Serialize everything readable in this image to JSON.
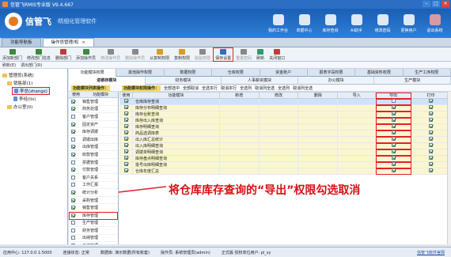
{
  "window": {
    "title": "信管飞RMIS专业版 V9.4.667"
  },
  "header": {
    "brand": "信管飞",
    "slogan": "·精细化管理软件",
    "nav": [
      {
        "label": "我的工作台",
        "icon": "desk-icon"
      },
      {
        "label": "单据中心",
        "icon": "document-icon"
      },
      {
        "label": "库存查询",
        "icon": "warehouse-icon"
      },
      {
        "label": "AI助手",
        "icon": "ai-icon"
      },
      {
        "label": "修改密码",
        "icon": "key-icon"
      },
      {
        "label": "更换用户",
        "icon": "user-switch-icon"
      },
      {
        "label": "退出系统",
        "icon": "power-icon"
      }
    ]
  },
  "doc_tabs": [
    {
      "label": "功能导航板",
      "active": false
    },
    {
      "label": "操作员管理/权",
      "active": true
    }
  ],
  "toolbar": {
    "buttons": [
      {
        "label": "添加新部门",
        "color": "#3b8a3b",
        "disabled": false
      },
      {
        "label": "修改部门信息",
        "color": "#3b8a3b",
        "disabled": false
      },
      {
        "label": "删除部门",
        "color": "#c23b3b",
        "disabled": false
      },
      {
        "label": "添加操作员",
        "color": "#3b8a3b",
        "disabled": false
      },
      {
        "label": "修改操作员",
        "color": "#888888",
        "disabled": true
      },
      {
        "label": "删除操作员",
        "color": "#888888",
        "disabled": true
      },
      {
        "label": "从复制权限",
        "color": "#d99a2b",
        "disabled": false
      },
      {
        "label": "复制权限",
        "color": "#d99a2b",
        "disabled": false
      },
      {
        "label": "粘贴权限",
        "color": "#888888",
        "disabled": true
      },
      {
        "label": "保存设置",
        "color": "#2f6fc2",
        "disabled": false,
        "highlight": true
      },
      {
        "label": "重置密码",
        "color": "#888888",
        "disabled": true
      },
      {
        "label": "刷新",
        "color": "#2f9a6a",
        "disabled": false
      },
      {
        "label": "关闭窗口",
        "color": "#c23b3b",
        "disabled": false
      }
    ],
    "sub": [
      "刷新(E)",
      "调出部门(R)"
    ]
  },
  "tree": {
    "root": "管理员(系统)",
    "dept": "销售部(1)",
    "user1": "李总(zhangs)",
    "user2": "李经(lis)",
    "office": "办公室(0)"
  },
  "perm_tabs": [
    {
      "label": "功能模块权限",
      "active": true
    },
    {
      "label": "其他操作权限",
      "active": false
    },
    {
      "label": "数据权限",
      "active": false
    },
    {
      "label": "仓库权限",
      "active": false
    },
    {
      "label": "资金账户",
      "active": false
    },
    {
      "label": "报表字段权限",
      "active": false
    },
    {
      "label": "基础资料权限",
      "active": false
    },
    {
      "label": "生产工序权限",
      "active": false
    }
  ],
  "sub_tabs": [
    {
      "label": "进销存模块",
      "active": true
    },
    {
      "label": "财务模块",
      "active": false
    },
    {
      "label": "人事薪资模块",
      "active": false
    },
    {
      "label": "办公模块",
      "active": false
    },
    {
      "label": "生产模块",
      "active": false
    }
  ],
  "left_bar": {
    "head": "功能模块列表操作：",
    "items": [
      "全部选择",
      "全部取消"
    ]
  },
  "right_bar": {
    "head": "功能模块权限操作：",
    "items": [
      "全部选中",
      "全部取消",
      "全选本行",
      "取消本行",
      "全选列",
      "取消列全选",
      "全选列",
      "取消列全选"
    ]
  },
  "left_table": {
    "headers": [
      "使用",
      "功能模块"
    ],
    "rows": [
      {
        "name": "销售管理",
        "checked": true
      },
      {
        "name": "商务处理",
        "checked": true
      },
      {
        "name": "客户管理",
        "checked": false
      },
      {
        "name": "固定资产",
        "checked": true
      },
      {
        "name": "库存调拨",
        "checked": true
      },
      {
        "name": "调拨出库",
        "checked": false
      },
      {
        "name": "出库管理",
        "checked": true
      },
      {
        "name": "收款管理",
        "checked": true
      },
      {
        "name": "票据管理",
        "checked": false
      },
      {
        "name": "付款管理",
        "checked": true
      },
      {
        "name": "客户关系",
        "checked": false
      },
      {
        "name": "工作汇报",
        "checked": false
      },
      {
        "name": "统计分析",
        "checked": true
      },
      {
        "name": "采购管理",
        "checked": true
      },
      {
        "name": "销售管理",
        "checked": true
      },
      {
        "name": "库存管理",
        "checked": true,
        "highlight": true
      },
      {
        "name": "生产管理",
        "checked": false
      },
      {
        "name": "财务管理",
        "checked": false
      },
      {
        "name": "出纳管理",
        "checked": false
      },
      {
        "name": "工资管理",
        "checked": false
      },
      {
        "name": "客户关系管理",
        "checked": true
      }
    ]
  },
  "right_table": {
    "headers": [
      "使用",
      "功能模块",
      "新增",
      "修改",
      "删除",
      "导入",
      "导出",
      "打印"
    ],
    "rows": [
      {
        "name": "仓库库存查询",
        "use": true,
        "export": false,
        "print": true,
        "style": "first"
      },
      {
        "name": "库存分布明细查询",
        "use": true,
        "export": true,
        "print": true,
        "style": "yellow"
      },
      {
        "name": "库存台账查询",
        "use": true,
        "export": true,
        "print": true,
        "style": "yellow"
      },
      {
        "name": "库存出入库查询",
        "use": true,
        "export": true,
        "print": true,
        "style": "yellow"
      },
      {
        "name": "库存明细查询",
        "use": true,
        "export": true,
        "print": true,
        "style": "yellow"
      },
      {
        "name": "商品选调库表",
        "use": true,
        "export": true,
        "print": true,
        "style": "yellow"
      },
      {
        "name": "出入库汇总统计",
        "use": true,
        "export": true,
        "print": true,
        "style": "yellow"
      },
      {
        "name": "出入库明细查询",
        "use": true,
        "export": true,
        "print": true,
        "style": "yellow"
      },
      {
        "name": "调拨单明细查询",
        "use": true,
        "export": true,
        "print": true,
        "style": "yellow"
      },
      {
        "name": "库存盘点明细查询",
        "use": true,
        "export": true,
        "print": true,
        "style": "yellow"
      },
      {
        "name": "批号出库明细查询",
        "use": true,
        "export": true,
        "print": true,
        "style": "yellow"
      },
      {
        "name": "仓库年度汇总",
        "use": true,
        "export": true,
        "print": true,
        "style": "yellow"
      }
    ]
  },
  "annotation": {
    "text": "将仓库库存查询的“导出”权限勾选取消",
    "color": "#d80f16"
  },
  "status": {
    "server": "应用中心: 127.0.0.1:5000",
    "conn": "连接状态: 正常",
    "db": "数据库: 演示数据(所有账套)",
    "operator": "操作员: 系统管理员(admin)",
    "version": "正式版 授权单位用户: pl_sy",
    "link": "信管飞软件官网"
  },
  "accent_red": "#e3202a"
}
